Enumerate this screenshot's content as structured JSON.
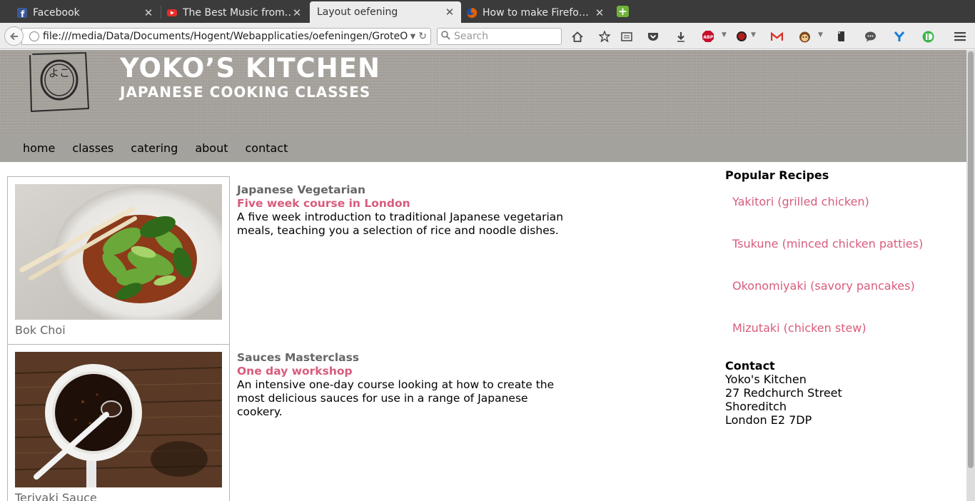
{
  "browser": {
    "tabs": [
      {
        "title": "Facebook",
        "icon": "facebook-icon",
        "color": "#3b5998"
      },
      {
        "title": "The Best Music from…",
        "icon": "youtube-icon",
        "color": "#e52d27"
      },
      {
        "title": "Layout oefening",
        "icon": "",
        "active": true
      },
      {
        "title": "How to make Firefo…",
        "icon": "firefox-icon",
        "color": "#e66000"
      }
    ],
    "url": "file:///media/Data/Documents/Hogent/Webapplicaties/oefeningen/GroteO",
    "search_placeholder": "Search",
    "toolbar_icons": {
      "abp_label": "ABP"
    }
  },
  "site": {
    "logo_glyph": "よこ",
    "title": "YOKO’S KITCHEN",
    "subtitle": "JAPANESE COOKING CLASSES",
    "nav": [
      "home",
      "classes",
      "catering",
      "about",
      "contact"
    ],
    "courses": [
      {
        "caption": "Bok Choi",
        "name": "Japanese Vegetarian",
        "sub": "Five week course in London",
        "desc": "A five week introduction to traditional Japanese vegetarian meals, teaching you a selection of rice and noodle dishes."
      },
      {
        "caption": "Teriyaki Sauce",
        "name": "Sauces Masterclass",
        "sub": "One day workshop",
        "desc": "An intensive one-day course looking at how to create the most delicious sauces for use in a range of Japanese cookery."
      }
    ],
    "popular": {
      "heading": "Popular Recipes",
      "items": [
        "Yakitori (grilled chicken)",
        "Tsukune (minced chicken patties)",
        "Okonomiyaki (savory pancakes)",
        "Mizutaki (chicken stew)"
      ]
    },
    "contact": {
      "heading": "Contact",
      "lines": [
        "Yoko's Kitchen",
        "27 Redchurch Street",
        "Shoreditch",
        "London E2 7DP"
      ]
    },
    "colors": {
      "accent": "#d85c7c",
      "nav_bg": "#a3a29d",
      "header_bg": "#a8a49f"
    }
  }
}
